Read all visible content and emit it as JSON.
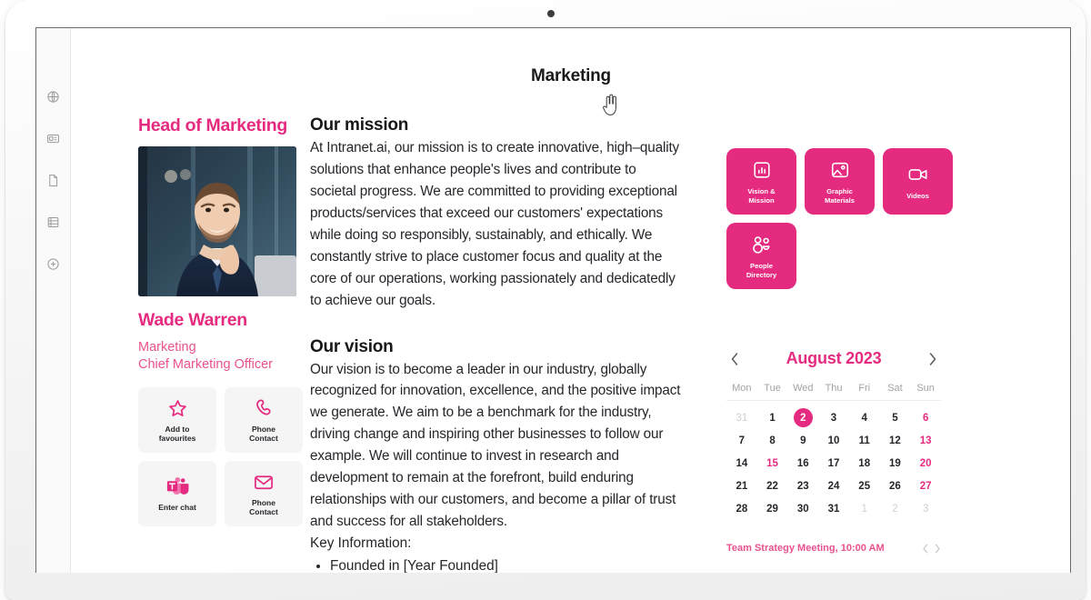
{
  "device": {
    "camera": "camera-dot"
  },
  "app_rail": {
    "items": [
      {
        "icon": "globe-icon",
        "name": "intranet-home"
      },
      {
        "icon": "news-card-icon",
        "name": "news"
      },
      {
        "icon": "document-icon",
        "name": "documents"
      },
      {
        "icon": "database-list-icon",
        "name": "lists"
      },
      {
        "icon": "plus-circle-icon",
        "name": "add-new"
      }
    ]
  },
  "page": {
    "title": "Marketing",
    "cursor": "pointer-hand-cursor"
  },
  "profile": {
    "role_title": "Head of Marketing",
    "photo_alt": "portrait-photo",
    "name": "Wade Warren",
    "department": "Marketing",
    "job_title": "Chief Marketing Officer",
    "actions": [
      {
        "label": "Add to\nfavourites",
        "icon": "star-icon",
        "name": "add-to-favourites-button"
      },
      {
        "label": "Phone\nContact",
        "icon": "phone-icon",
        "name": "phone-contact-button"
      },
      {
        "label": "Enter chat",
        "icon": "teams-icon",
        "name": "enter-chat-button"
      },
      {
        "label": "Phone\nContact",
        "icon": "envelope-icon",
        "name": "email-contact-button"
      }
    ]
  },
  "article": {
    "mission_heading": "Our mission",
    "mission_body": "At Intranet.ai, our mission is to create innovative, high–quality solutions that enhance people's lives and contribute to societal progress. We are committed to providing exceptional products/services that exceed our customers' expectations while doing so responsibly, sustainably, and ethically. We constantly strive to place customer focus and quality at the core of our operations, working passionately and dedicatedly to achieve our goals.",
    "vision_heading": "Our vision",
    "vision_body": "Our vision is to become a leader in our industry, globally recognized for innovation, excellence, and the positive impact we generate. We aim to be a benchmark for the industry, driving change and inspiring other businesses to follow our example. We will continue to invest in research and development to remain at the forefront, build enduring relationships with our customers, and become a pillar of trust and success for all stakeholders.",
    "key_info_label": "Key Information:",
    "key_info_items": [
      "Founded in [Year Founded]"
    ]
  },
  "quicklinks": [
    {
      "label": "Vision &\nMission",
      "icon": "bar-chart-icon",
      "name": "quicklink-vision-mission"
    },
    {
      "label": "Graphic\nMaterials",
      "icon": "image-icon",
      "name": "quicklink-graphic-materials"
    },
    {
      "label": "Videos",
      "icon": "video-camera-icon",
      "name": "quicklink-videos"
    },
    {
      "label": "People\nDirectory",
      "icon": "people-icon",
      "name": "quicklink-people-directory"
    }
  ],
  "calendar": {
    "month_label": "August 2023",
    "prev_label": "‹",
    "next_label": "›",
    "weekdays": [
      "Mon",
      "Tue",
      "Wed",
      "Thu",
      "Fri",
      "Sat",
      "Sun"
    ],
    "days": [
      {
        "n": "31",
        "style": "muted"
      },
      {
        "n": "1",
        "style": "normal"
      },
      {
        "n": "2",
        "style": "today"
      },
      {
        "n": "3",
        "style": "normal"
      },
      {
        "n": "4",
        "style": "normal"
      },
      {
        "n": "5",
        "style": "normal"
      },
      {
        "n": "6",
        "style": "accent"
      },
      {
        "n": "7",
        "style": "normal"
      },
      {
        "n": "8",
        "style": "normal"
      },
      {
        "n": "9",
        "style": "normal"
      },
      {
        "n": "10",
        "style": "normal"
      },
      {
        "n": "11",
        "style": "normal"
      },
      {
        "n": "12",
        "style": "normal"
      },
      {
        "n": "13",
        "style": "accent"
      },
      {
        "n": "14",
        "style": "normal"
      },
      {
        "n": "15",
        "style": "accent"
      },
      {
        "n": "16",
        "style": "normal"
      },
      {
        "n": "17",
        "style": "normal"
      },
      {
        "n": "18",
        "style": "normal"
      },
      {
        "n": "19",
        "style": "normal"
      },
      {
        "n": "20",
        "style": "accent"
      },
      {
        "n": "21",
        "style": "normal"
      },
      {
        "n": "22",
        "style": "normal"
      },
      {
        "n": "23",
        "style": "normal"
      },
      {
        "n": "24",
        "style": "normal"
      },
      {
        "n": "25",
        "style": "normal"
      },
      {
        "n": "26",
        "style": "normal"
      },
      {
        "n": "27",
        "style": "accent"
      },
      {
        "n": "28",
        "style": "normal"
      },
      {
        "n": "29",
        "style": "normal"
      },
      {
        "n": "30",
        "style": "normal"
      },
      {
        "n": "31",
        "style": "normal"
      },
      {
        "n": "1",
        "style": "muted"
      },
      {
        "n": "2",
        "style": "muted"
      },
      {
        "n": "3",
        "style": "muted"
      }
    ],
    "event": "Team Strategy Meeting, 10:00 AM"
  },
  "colors": {
    "accent": "#e52b7f",
    "accent_soft": "#e8528f",
    "text": "#26262b",
    "tile_bg": "#f5f5f6",
    "muted": "#a3a3a3"
  }
}
